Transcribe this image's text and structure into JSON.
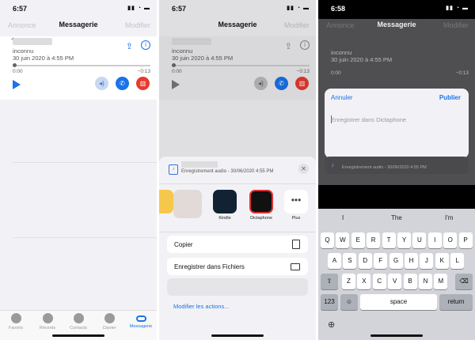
{
  "panel1": {
    "time": "6:57",
    "indicators": "▮▮ ◔ ▬",
    "nav": {
      "left": "Annonce",
      "title": "Messagerie",
      "right": "Modifier"
    },
    "vm": {
      "number_prefix": "+",
      "name": "inconnu",
      "date": "30 juin 2020 à 4:55 PM",
      "elapsed": "0:00",
      "remaining": "−0:13"
    },
    "tabs": [
      "Favoris",
      "Récents",
      "Contacts",
      "Clavier",
      "Messagerie"
    ]
  },
  "panel2": {
    "time": "6:57",
    "nav": {
      "title": "Messagerie",
      "right": "Modifier"
    },
    "vm": {
      "name": "inconnu",
      "date": "30 juin 2020 à 4:55 PM",
      "elapsed": "0:00",
      "remaining": "−0:13"
    },
    "share": {
      "subtitle": "Enregistrement audio - 30/06/2020 4:55 PM",
      "apps": [
        "Kindle",
        "Dictaphone",
        "Plus"
      ],
      "actions": [
        "Copier",
        "Enregistrer dans Fichiers"
      ],
      "modify": "Modifier les actions..."
    }
  },
  "panel3": {
    "time": "6:58",
    "nav": {
      "left": "Annonce",
      "title": "Messagerie",
      "right": "Modifier"
    },
    "vm": {
      "name": "inconnu",
      "date": "30 juin 2020 à 4:55 PM",
      "elapsed": "0:00",
      "remaining": "−0:13"
    },
    "dialog": {
      "cancel": "Annuler",
      "publish": "Publier",
      "placeholder": "Enregistrer dans Dictaphone"
    },
    "attachment": "Enregistrement audio - 30/06/2020 4:55 PM",
    "suggestions": [
      "I",
      "The",
      "I'm"
    ],
    "keys": {
      "row1": [
        "Q",
        "W",
        "E",
        "R",
        "T",
        "Y",
        "U",
        "I",
        "O",
        "P"
      ],
      "row2": [
        "A",
        "S",
        "D",
        "F",
        "G",
        "H",
        "J",
        "K",
        "L"
      ],
      "row3": [
        "Z",
        "X",
        "C",
        "V",
        "B",
        "N",
        "M"
      ],
      "num": "123",
      "space": "space",
      "ret": "return"
    }
  }
}
